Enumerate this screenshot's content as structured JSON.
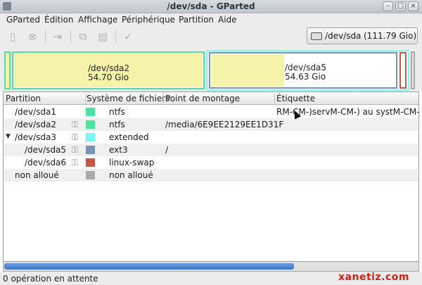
{
  "window": {
    "title": "/dev/sda - GParted",
    "minimize_symbol": "–",
    "maximize_symbol": "□",
    "close_symbol": "×"
  },
  "menu": [
    "GParted",
    "Édition",
    "Affichage",
    "Périphérique",
    "Partition",
    "Aide"
  ],
  "toolbar": {
    "icons": [
      "new-icon",
      "delete-icon",
      "resize-move-icon",
      "copy-icon",
      "paste-icon",
      "apply-icon"
    ],
    "device": {
      "label": "/dev/sda",
      "size": "(111.79 Gio)"
    }
  },
  "diskmap": {
    "sda2": {
      "name": "/dev/sda2",
      "size": "54.70 Gio"
    },
    "sda5": {
      "name": "/dev/sda5",
      "size": "54.63 Gio"
    }
  },
  "list": {
    "headers": [
      "Partition",
      "Système de fichiers",
      "Point de montage",
      "Étiquette"
    ],
    "rows": [
      {
        "partition": "/dev/sda1",
        "fs": "ntfs",
        "mount": "",
        "label": "RM-CM-)servM-CM-) au systM-CM-(me",
        "color": "#4ee3a1"
      },
      {
        "partition": "/dev/sda2",
        "fs": "ntfs",
        "mount": "/media/6E9EE2129EE1D31F",
        "label": "",
        "color": "#4ee3a1"
      },
      {
        "partition": "/dev/sda3",
        "fs": "extended",
        "mount": "",
        "label": "",
        "color": "#7ff7f4"
      },
      {
        "partition": "/dev/sda5",
        "fs": "ext3",
        "mount": "/",
        "label": "",
        "color": "#7895b8"
      },
      {
        "partition": "/dev/sda6",
        "fs": "linux-swap",
        "mount": "",
        "label": "",
        "color": "#c2574a"
      },
      {
        "partition": "non alloué",
        "fs": "non alloué",
        "mount": "",
        "label": "",
        "color": "#a9a9a9"
      }
    ]
  },
  "scrollbar": {
    "position": 0.7
  },
  "status": {
    "text": "0 opération en attente"
  },
  "watermark": "xanetiz.com",
  "colors": {
    "ntfs": "#4ee3a1",
    "extended": "#7ff7f4",
    "ext3": "#7895b8",
    "linux_swap": "#c2574a",
    "unallocated": "#a9a9a9",
    "used_fill": "#f5f2a9",
    "accent": "#3c77c7"
  }
}
